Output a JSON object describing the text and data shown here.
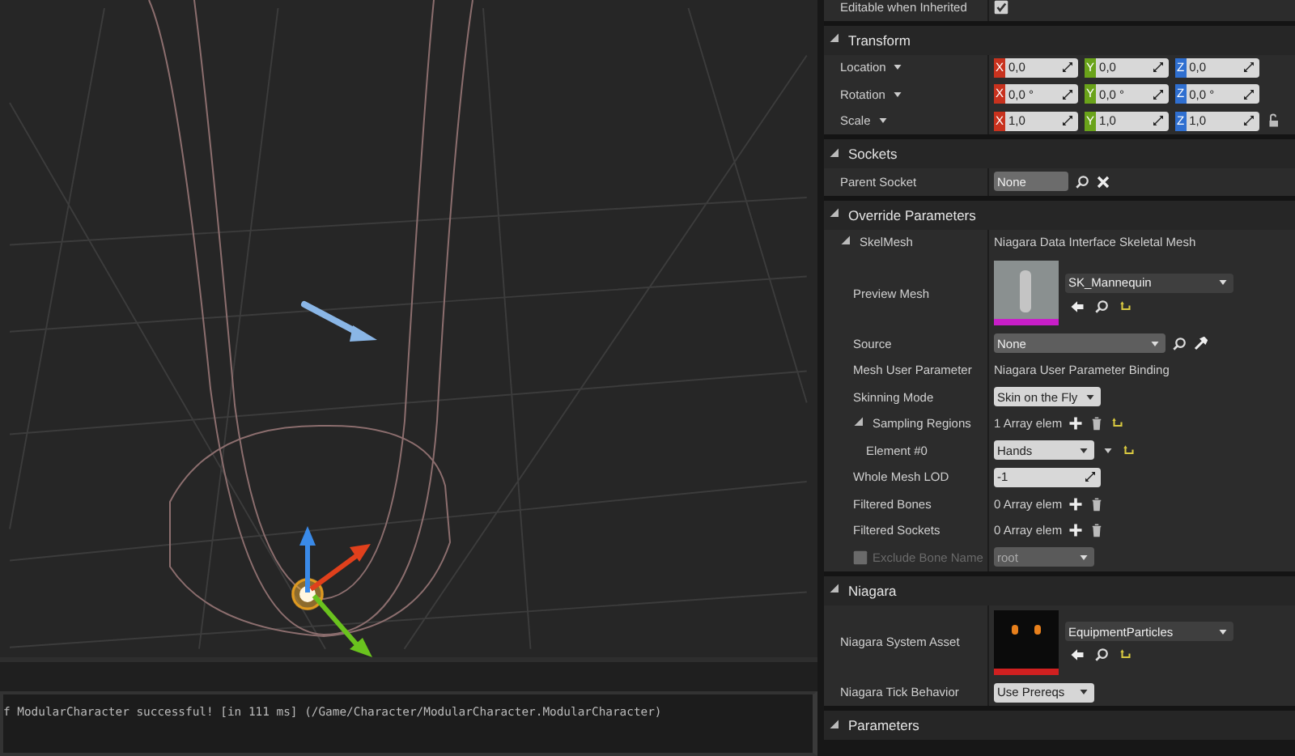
{
  "log": {
    "text": "f ModularCharacter successful! [in 111 ms] (/Game/Character/ModularCharacter.ModularCharacter)"
  },
  "details": {
    "top_rows": [
      {
        "kind": "checkbox",
        "label": "Editable when Inherited",
        "checked": true
      }
    ],
    "sections": [
      {
        "title": "Transform",
        "expanded": true,
        "rows": [
          {
            "kind": "vector",
            "label": "Location",
            "components": [
              {
                "axis": "X",
                "color": "#c8321e",
                "value": "0,0"
              },
              {
                "axis": "Y",
                "color": "#6aa31a",
                "value": "0,0"
              },
              {
                "axis": "Z",
                "color": "#2f6fd0",
                "value": "0,0"
              }
            ]
          },
          {
            "kind": "vector",
            "label": "Rotation",
            "components": [
              {
                "axis": "X",
                "color": "#c8321e",
                "value": "0,0 °"
              },
              {
                "axis": "Y",
                "color": "#6aa31a",
                "value": "0,0 °"
              },
              {
                "axis": "Z",
                "color": "#2f6fd0",
                "value": "0,0 °"
              }
            ]
          },
          {
            "kind": "vector",
            "label": "Scale",
            "has_lock": true,
            "components": [
              {
                "axis": "X",
                "color": "#c8321e",
                "value": "1,0"
              },
              {
                "axis": "Y",
                "color": "#6aa31a",
                "value": "1,0"
              },
              {
                "axis": "Z",
                "color": "#2f6fd0",
                "value": "1,0"
              }
            ]
          }
        ]
      },
      {
        "title": "Sockets",
        "expanded": true,
        "rows": [
          {
            "kind": "socket",
            "label": "Parent Socket",
            "value": "None"
          }
        ]
      },
      {
        "title": "Override Parameters",
        "expanded": true,
        "rows": [
          {
            "kind": "group",
            "label": "SkelMesh",
            "value": "Niagara Data Interface Skeletal Mesh",
            "expanded": true,
            "children": [
              {
                "kind": "mesh",
                "label": "Preview Mesh",
                "color": "#c81ec8",
                "value": "SK_Mannequin",
                "reset": true
              },
              {
                "kind": "combo",
                "label": "Source",
                "value": "None"
              },
              {
                "kind": "text",
                "label": "Mesh User Parameter",
                "value": "Niagara User Parameter Binding"
              },
              {
                "kind": "dropdown",
                "label": "Skinning Mode",
                "value": "Skin on the Fly",
                "disabled": false
              },
              {
                "kind": "array",
                "label": "Sampling Regions",
                "value": "1 Array elem",
                "reset": true,
                "expanded": true,
                "children": [
                  {
                    "kind": "element",
                    "label": "Element #0",
                    "value": "Hands",
                    "reset": true
                  }
                ]
              },
              {
                "kind": "number",
                "label": "Whole Mesh LOD",
                "value": "-1"
              },
              {
                "kind": "array",
                "label": "Filtered Bones",
                "value": "0 Array elem"
              },
              {
                "kind": "array",
                "label": "Filtered Sockets",
                "value": "0 Array elem"
              },
              {
                "kind": "dropdown",
                "label": "Exclude Bone Name",
                "value": "root",
                "disabled": true,
                "toggle": {
                  "checked": false
                }
              }
            ]
          }
        ]
      },
      {
        "title": "Niagara",
        "expanded": true,
        "rows": [
          {
            "kind": "system",
            "label": "Niagara System Asset",
            "color": "#d02020",
            "value": "EquipmentParticles",
            "reset": true
          },
          {
            "kind": "dropdown",
            "label": "Niagara Tick Behavior",
            "value": "Use Prereqs",
            "disabled": false
          }
        ]
      },
      {
        "title": "Parameters",
        "expanded": true
      }
    ]
  }
}
